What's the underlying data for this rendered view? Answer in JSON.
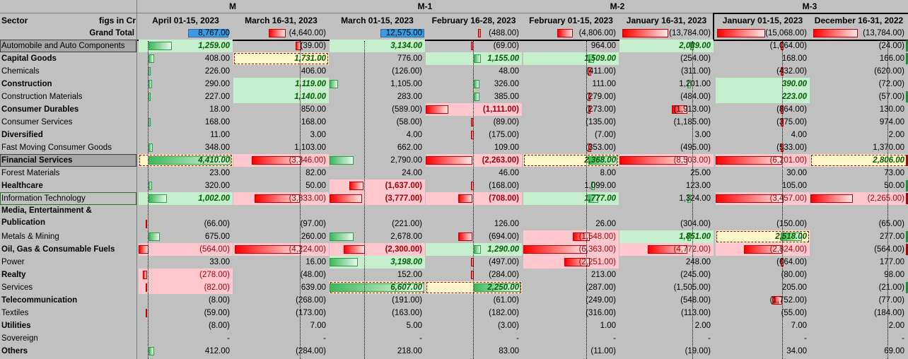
{
  "sheet": {
    "groups": [
      "M",
      "M-1",
      "M-2",
      "M-3"
    ],
    "sector_header": "Sector",
    "units_header": "figs in Cr",
    "periods": [
      "April 01-15, 2023",
      "March 16-31, 2023",
      "March 01-15, 2023",
      "February 16-28, 2023",
      "February 01-15, 2023",
      "January 16-31, 2023",
      "January 01-15, 2023",
      "December 16-31, 2022"
    ],
    "grand_total": {
      "label": "Grand Total",
      "values": [
        "8,767.00",
        "(4,640.00)",
        "12,575.00",
        "(488.00)",
        "(4,806.00)",
        "(13,784.00)",
        "(15,068.00)",
        "(13,784.00)"
      ]
    },
    "rows": [
      {
        "label": "Automobile and Auto Components",
        "values": [
          "1,259.00",
          "(39.00)",
          "3,134.00",
          "(69.00)",
          "964.00",
          "2,089.00",
          "(1,064.00)",
          "(24.00)"
        ]
      },
      {
        "label": "Capital Goods",
        "values": [
          "408.00",
          "1,731.00",
          "776.00",
          "1,155.00",
          "1,509.00",
          "(254.00)",
          "168.00",
          "166.00"
        ]
      },
      {
        "label": "Chemicals",
        "values": [
          "226.00",
          "406.00",
          "(126.00)",
          "48.00",
          "(411.00)",
          "(311.00)",
          "(432.00)",
          "(620.00)"
        ]
      },
      {
        "label": "Construction",
        "values": [
          "290.00",
          "1,119.00",
          "1,105.00",
          "326.00",
          "111.00",
          "1,201.00",
          "390.00",
          "(72.00)"
        ]
      },
      {
        "label": "Construction Materials",
        "values": [
          "227.00",
          "1,140.00",
          "283.00",
          "385.00",
          "(279.00)",
          "(484.00)",
          "223.00",
          "(57.00)"
        ]
      },
      {
        "label": "Consumer Durables",
        "values": [
          "18.00",
          "850.00",
          "(589.00)",
          "(1,111.00)",
          "(273.00)",
          "(1,913.00)",
          "(864.00)",
          "130.00"
        ]
      },
      {
        "label": "Consumer Services",
        "values": [
          "168.00",
          "168.00",
          "(58.00)",
          "(89.00)",
          "(135.00)",
          "(1,185.00)",
          "(375.00)",
          "974.00"
        ]
      },
      {
        "label": "Diversified",
        "values": [
          "11.00",
          "3.00",
          "4.00",
          "(175.00)",
          "(7.00)",
          "3.00",
          "4.00",
          "2.00"
        ]
      },
      {
        "label": "Fast Moving Consumer Goods",
        "values": [
          "348.00",
          "1,103.00",
          "662.00",
          "109.00",
          "(353.00)",
          "(495.00)",
          "(533.00)",
          "1,370.00"
        ]
      },
      {
        "label": "Financial Services",
        "values": [
          "4,410.00",
          "(3,346.00)",
          "2,790.00",
          "(2,263.00)",
          "2,368.00",
          "(8,503.00)",
          "(6,201.00)",
          "2,806.00"
        ]
      },
      {
        "label": "Forest Materials",
        "values": [
          "23.00",
          "82.00",
          "24.00",
          "46.00",
          "8.00",
          "25.00",
          "30.00",
          "73.00"
        ]
      },
      {
        "label": "Healthcare",
        "values": [
          "320.00",
          "50.00",
          "(1,637.00)",
          "(168.00)",
          "1,099.00",
          "123.00",
          "105.00",
          "50.00"
        ]
      },
      {
        "label": "Information Technology",
        "values": [
          "1,002.00",
          "(3,333.00)",
          "(3,777.00)",
          "(708.00)",
          "1,777.00",
          "1,324.00",
          "(3,457.00)",
          "(2,265.00)"
        ]
      },
      {
        "label_line1": "Media, Entertainment &",
        "label_line2": "Publication",
        "values": [
          "(66.00)",
          "(97.00)",
          "(221.00)",
          "126.00",
          "26.00",
          "(304.00)",
          "(150.00)",
          "(65.00)"
        ]
      },
      {
        "label": "Metals & Mining",
        "values": [
          "675.00",
          "260.00",
          "2,678.00",
          "(694.00)",
          "(1,548.00)",
          "1,851.00",
          "2,518.00",
          "277.00"
        ]
      },
      {
        "label": "Oil, Gas & Consumable Fuels",
        "values": [
          "(564.00)",
          "(4,224.00)",
          "(2,300.00)",
          "1,290.00",
          "(6,363.00)",
          "(4,772.00)",
          "(2,824.00)",
          "(564.00)"
        ]
      },
      {
        "label": "Power",
        "values": [
          "33.00",
          "16.00",
          "3,198.00",
          "(497.00)",
          "(2,251.00)",
          "248.00",
          "(664.00)",
          "177.00"
        ]
      },
      {
        "label": "Realty",
        "values": [
          "(278.00)",
          "(48.00)",
          "152.00",
          "(284.00)",
          "213.00",
          "(245.00)",
          "(80.00)",
          "98.00"
        ]
      },
      {
        "label": "Services",
        "values": [
          "(82.00)",
          "639.00",
          "6,607.00",
          "2,250.00",
          "(287.00)",
          "(1,505.00)",
          "205.00",
          "(21.00)"
        ]
      },
      {
        "label": "Telecommunication",
        "values": [
          "(8.00)",
          "(268.00)",
          "(191.00)",
          "(61.00)",
          "(249.00)",
          "(548.00)",
          "(1,752.00)",
          "(77.00)"
        ]
      },
      {
        "label": "Textiles",
        "values": [
          "(59.00)",
          "(173.00)",
          "(163.00)",
          "(182.00)",
          "(316.00)",
          "(113.00)",
          "(55.00)",
          "(184.00)"
        ]
      },
      {
        "label": "Utilities",
        "values": [
          "(8.00)",
          "7.00",
          "5.00",
          "(3.00)",
          "1.00",
          "2.00",
          "7.00",
          "2.00"
        ]
      },
      {
        "label": "Sovereign",
        "values": [
          "-",
          "-",
          "-",
          "-",
          "-",
          "-",
          "-",
          "-"
        ]
      },
      {
        "label": "Others",
        "values": [
          "412.00",
          "(284.00)",
          "218.00",
          "83.00",
          "(11.00)",
          "(19.00)",
          "34.00",
          "69.00"
        ]
      }
    ],
    "colors": {
      "positive": "#c6efce",
      "negative": "#ffc7ce",
      "highlight": "#fff6cc",
      "bar_positive": "#3cb95a",
      "bar_negative": "#ff0000",
      "bar_total": "#3a9ae2"
    }
  }
}
